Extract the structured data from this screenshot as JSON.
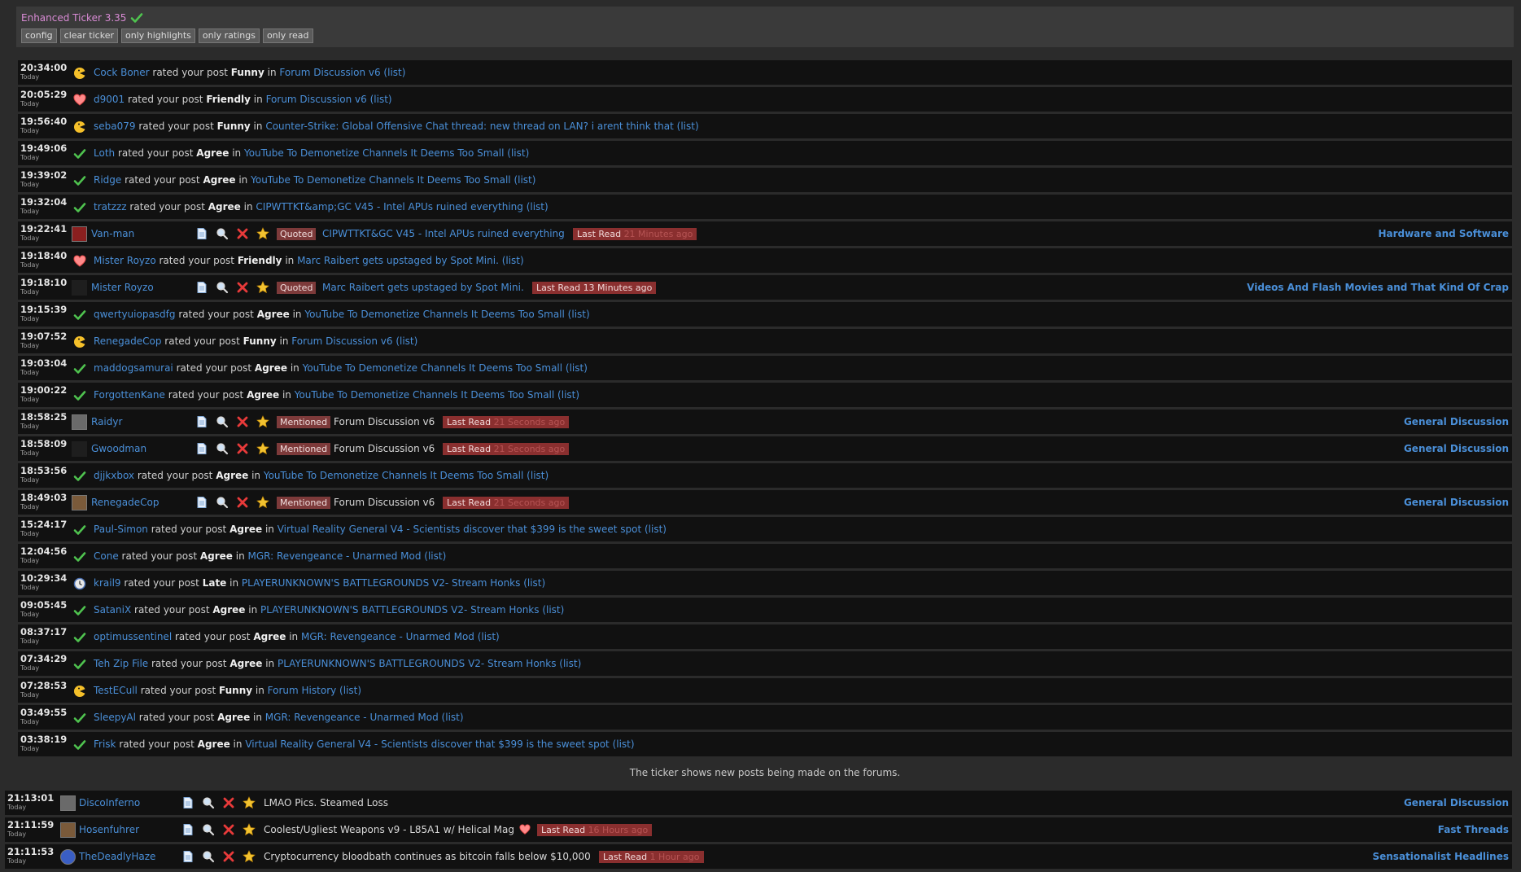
{
  "header": {
    "title": "Enhanced Ticker 3.35",
    "buttons": [
      "config",
      "clear ticker",
      "only highlights",
      "only ratings",
      "only read"
    ]
  },
  "today_label": "Today",
  "footer_text": "The ticker shows new posts being made on the forums.",
  "rating_connector": {
    "rated": " rated your post ",
    "in": " in ",
    "list": " (list)"
  },
  "tool_icons": [
    "document-icon",
    "magnifier-icon",
    "close-icon",
    "star-icon"
  ],
  "colors": {
    "link": "#4a8fd8",
    "tag": "#7d3a3a",
    "last_read": "#8a2f2f",
    "title": "#d98bd5"
  },
  "rows": [
    {
      "kind": "rating",
      "time": "20:34:00",
      "icon": "funny",
      "user": "Cock Boner",
      "rating": "Funny",
      "thread": "Forum Discussion v6"
    },
    {
      "kind": "rating",
      "time": "20:05:29",
      "icon": "heart",
      "user": "d9001",
      "rating": "Friendly",
      "thread": "Forum Discussion v6"
    },
    {
      "kind": "rating",
      "time": "19:56:40",
      "icon": "funny",
      "user": "seba079",
      "rating": "Funny",
      "thread": "Counter-Strike: Global Offensive Chat thread: new thread on LAN? i arent think that"
    },
    {
      "kind": "rating",
      "time": "19:49:06",
      "icon": "check",
      "user": "Loth",
      "rating": "Agree",
      "thread": "YouTube To Demonetize Channels It Deems Too Small"
    },
    {
      "kind": "rating",
      "time": "19:39:02",
      "icon": "check",
      "user": "Ridge",
      "rating": "Agree",
      "thread": "YouTube To Demonetize Channels It Deems Too Small"
    },
    {
      "kind": "rating",
      "time": "19:32:04",
      "icon": "check",
      "user": "tratzzz",
      "rating": "Agree",
      "thread": "CIPWTTKT&amp;GC V45 - Intel APUs ruined everything"
    },
    {
      "kind": "post",
      "time": "19:22:41",
      "avatar": "red",
      "user": "Van-man",
      "tag": "Quoted",
      "title": "CIPWTTKT&GC V45 - Intel APUs ruined everything",
      "title_color": "link",
      "last_read": "Last Read",
      "ago": "21 Minutes ago",
      "ago_visible": false,
      "forum": "Hardware and Software"
    },
    {
      "kind": "rating",
      "time": "19:18:40",
      "icon": "heart",
      "user": "Mister Royzo",
      "rating": "Friendly",
      "thread": "Marc Raibert gets upstaged by Spot Mini."
    },
    {
      "kind": "post",
      "time": "19:18:10",
      "avatar": "car",
      "user": "Mister Royzo",
      "tag": "Quoted",
      "title": "Marc Raibert gets upstaged by Spot Mini.",
      "title_color": "link",
      "last_read": "Last Read",
      "ago": "13 Minutes ago",
      "ago_visible": true,
      "forum": "Videos And Flash Movies and That Kind Of Crap"
    },
    {
      "kind": "rating",
      "time": "19:15:39",
      "icon": "check",
      "user": "qwertyuiopasdfg",
      "rating": "Agree",
      "thread": "YouTube To Demonetize Channels It Deems Too Small"
    },
    {
      "kind": "rating",
      "time": "19:07:52",
      "icon": "funny",
      "user": "RenegadeCop",
      "rating": "Funny",
      "thread": "Forum Discussion v6"
    },
    {
      "kind": "rating",
      "time": "19:03:04",
      "icon": "check",
      "user": "maddogsamurai",
      "rating": "Agree",
      "thread": "YouTube To Demonetize Channels It Deems Too Small"
    },
    {
      "kind": "rating",
      "time": "19:00:22",
      "icon": "check",
      "user": "ForgottenKane",
      "rating": "Agree",
      "thread": "YouTube To Demonetize Channels It Deems Too Small"
    },
    {
      "kind": "post",
      "time": "18:58:25",
      "avatar": "gray",
      "user": "Raidyr",
      "tag": "Mentioned",
      "title": "Forum Discussion v6",
      "title_color": "white",
      "last_read": "Last Read",
      "ago": "21 Seconds ago",
      "ago_visible": false,
      "forum": "General Discussion"
    },
    {
      "kind": "post",
      "time": "18:58:09",
      "avatar": "car",
      "user": "Gwoodman",
      "tag": "Mentioned",
      "title": "Forum Discussion v6",
      "title_color": "white",
      "last_read": "Last Read",
      "ago": "21 Seconds ago",
      "ago_visible": false,
      "forum": "General Discussion"
    },
    {
      "kind": "rating",
      "time": "18:53:56",
      "icon": "check",
      "user": "djjkxbox",
      "rating": "Agree",
      "thread": "YouTube To Demonetize Channels It Deems Too Small"
    },
    {
      "kind": "post",
      "time": "18:49:03",
      "avatar": "tan",
      "user": "RenegadeCop",
      "tag": "Mentioned",
      "title": "Forum Discussion v6",
      "title_color": "white",
      "last_read": "Last Read",
      "ago": "21 Seconds ago",
      "ago_visible": false,
      "forum": "General Discussion"
    },
    {
      "kind": "rating",
      "time": "15:24:17",
      "icon": "check",
      "user": "Paul-Simon",
      "rating": "Agree",
      "thread": "Virtual Reality General V4 - Scientists discover that $399 is the sweet spot"
    },
    {
      "kind": "rating",
      "time": "12:04:56",
      "icon": "check",
      "user": "Cone",
      "rating": "Agree",
      "thread": "MGR: Revengeance - Unarmed Mod"
    },
    {
      "kind": "rating",
      "time": "10:29:34",
      "icon": "clock",
      "user": "krail9",
      "rating": "Late",
      "thread": "PLAYERUNKNOWN'S BATTLEGROUNDS V2- Stream Honks"
    },
    {
      "kind": "rating",
      "time": "09:05:45",
      "icon": "check",
      "user": "SataniX",
      "rating": "Agree",
      "thread": "PLAYERUNKNOWN'S BATTLEGROUNDS V2- Stream Honks"
    },
    {
      "kind": "rating",
      "time": "08:37:17",
      "icon": "check",
      "user": "optimussentinel",
      "rating": "Agree",
      "thread": "MGR: Revengeance - Unarmed Mod"
    },
    {
      "kind": "rating",
      "time": "07:34:29",
      "icon": "check",
      "user": "Teh Zip File",
      "rating": "Agree",
      "thread": "PLAYERUNKNOWN'S BATTLEGROUNDS V2- Stream Honks"
    },
    {
      "kind": "rating",
      "time": "07:28:53",
      "icon": "funny",
      "user": "TestECull",
      "rating": "Funny",
      "thread": "Forum History"
    },
    {
      "kind": "rating",
      "time": "03:49:55",
      "icon": "check",
      "user": "SleepyAl",
      "rating": "Agree",
      "thread": "MGR: Revengeance - Unarmed Mod"
    },
    {
      "kind": "rating",
      "time": "03:38:19",
      "icon": "check",
      "user": "Frisk",
      "rating": "Agree",
      "thread": "Virtual Reality General V4 - Scientists discover that $399 is the sweet spot"
    }
  ],
  "rows2": [
    {
      "time": "21:13:01",
      "avatar": "gray",
      "user": "DiscoInferno",
      "title": "LMAO Pics. Steamed Loss",
      "heart": false,
      "last_read": "",
      "ago": "",
      "ago_visible": false,
      "forum": "General Discussion"
    },
    {
      "time": "21:11:59",
      "avatar": "tan",
      "user": "Hosenfuhrer",
      "title": "Coolest/Ugliest Weapons v9 - L85A1 w/ Helical Mag",
      "heart": true,
      "last_read": "Last Read",
      "ago": "16 Hours ago",
      "ago_visible": false,
      "forum": "Fast Threads"
    },
    {
      "time": "21:11:53",
      "avatar": "blue",
      "user": "TheDeadlyHaze",
      "title": "Cryptocurrency bloodbath continues as bitcoin falls below $10,000",
      "heart": false,
      "last_read": "Last Read",
      "ago": "1 Hour ago",
      "ago_visible": false,
      "forum": "Sensationalist Headlines"
    }
  ]
}
